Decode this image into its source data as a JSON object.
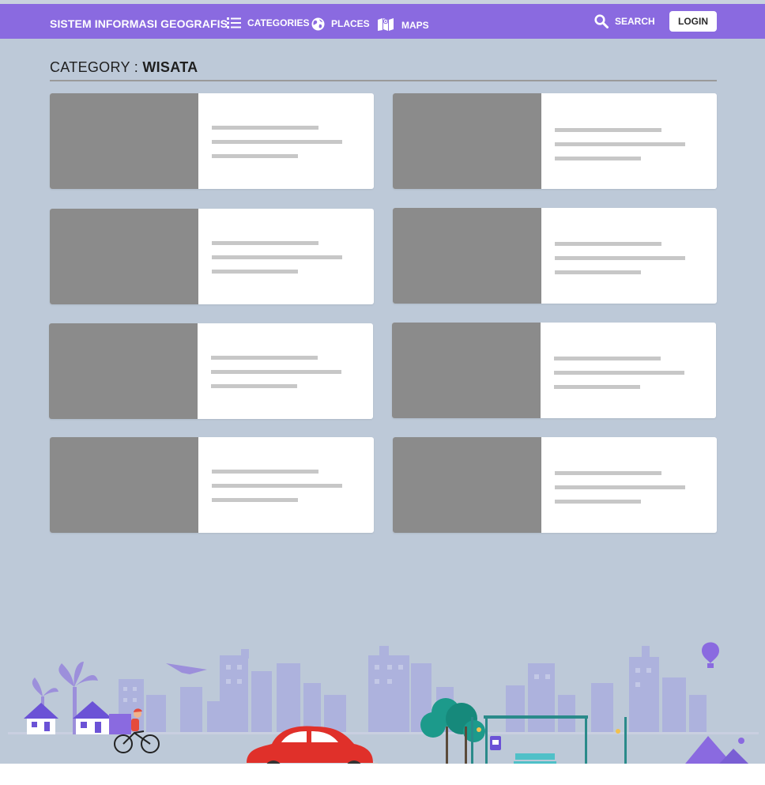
{
  "navbar": {
    "brand": "SISTEM INFORMASI GEOGRAFIS",
    "links": [
      {
        "label": "CATEGORIES",
        "icon": "list-icon"
      },
      {
        "label": "PLACES",
        "icon": "globe-icon"
      },
      {
        "label": "MAPS",
        "icon": "map-icon"
      }
    ],
    "search_label": "SEARCH",
    "login_label": "LOGIN"
  },
  "page": {
    "title_prefix": "CATEGORY : ",
    "title_value": "WISATA"
  },
  "cards_count": 8,
  "colors": {
    "navbar": "#8a6ae0",
    "background": "#bdc9d8",
    "thumbnail": "#8b8b8b",
    "placeholder_line": "#c7c7c7",
    "card": "#ffffff",
    "car": "#e0302a",
    "accent_purple": "#8a6ae0"
  }
}
